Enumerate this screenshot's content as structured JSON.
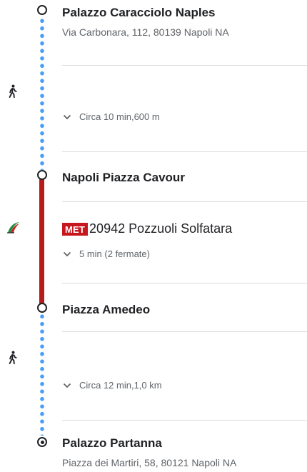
{
  "stops": [
    {
      "name": "Palazzo Caracciolo Naples",
      "address": "Via Carbonara, 112, 80139 Napoli NA"
    },
    {
      "name": "Napoli Piazza Cavour"
    },
    {
      "name": "Piazza Amedeo"
    },
    {
      "name": "Palazzo Partanna",
      "address": "Piazza dei Martiri, 58, 80121 Napoli NA"
    }
  ],
  "segments": [
    {
      "mode_icon": "walk-icon",
      "detail": "Circa 10 min,600 m"
    },
    {
      "mode_icon": "train-icon",
      "badge": "MET",
      "line": "20942 Pozzuoli Solfatara",
      "detail": "5 min (2 fermate)"
    },
    {
      "mode_icon": "walk-icon",
      "detail": "Circa 12 min,1,0 km"
    }
  ],
  "colors": {
    "walk_dots": "#4a9ff5",
    "metro_line": "#b71c1c",
    "badge": "#c8161e"
  }
}
